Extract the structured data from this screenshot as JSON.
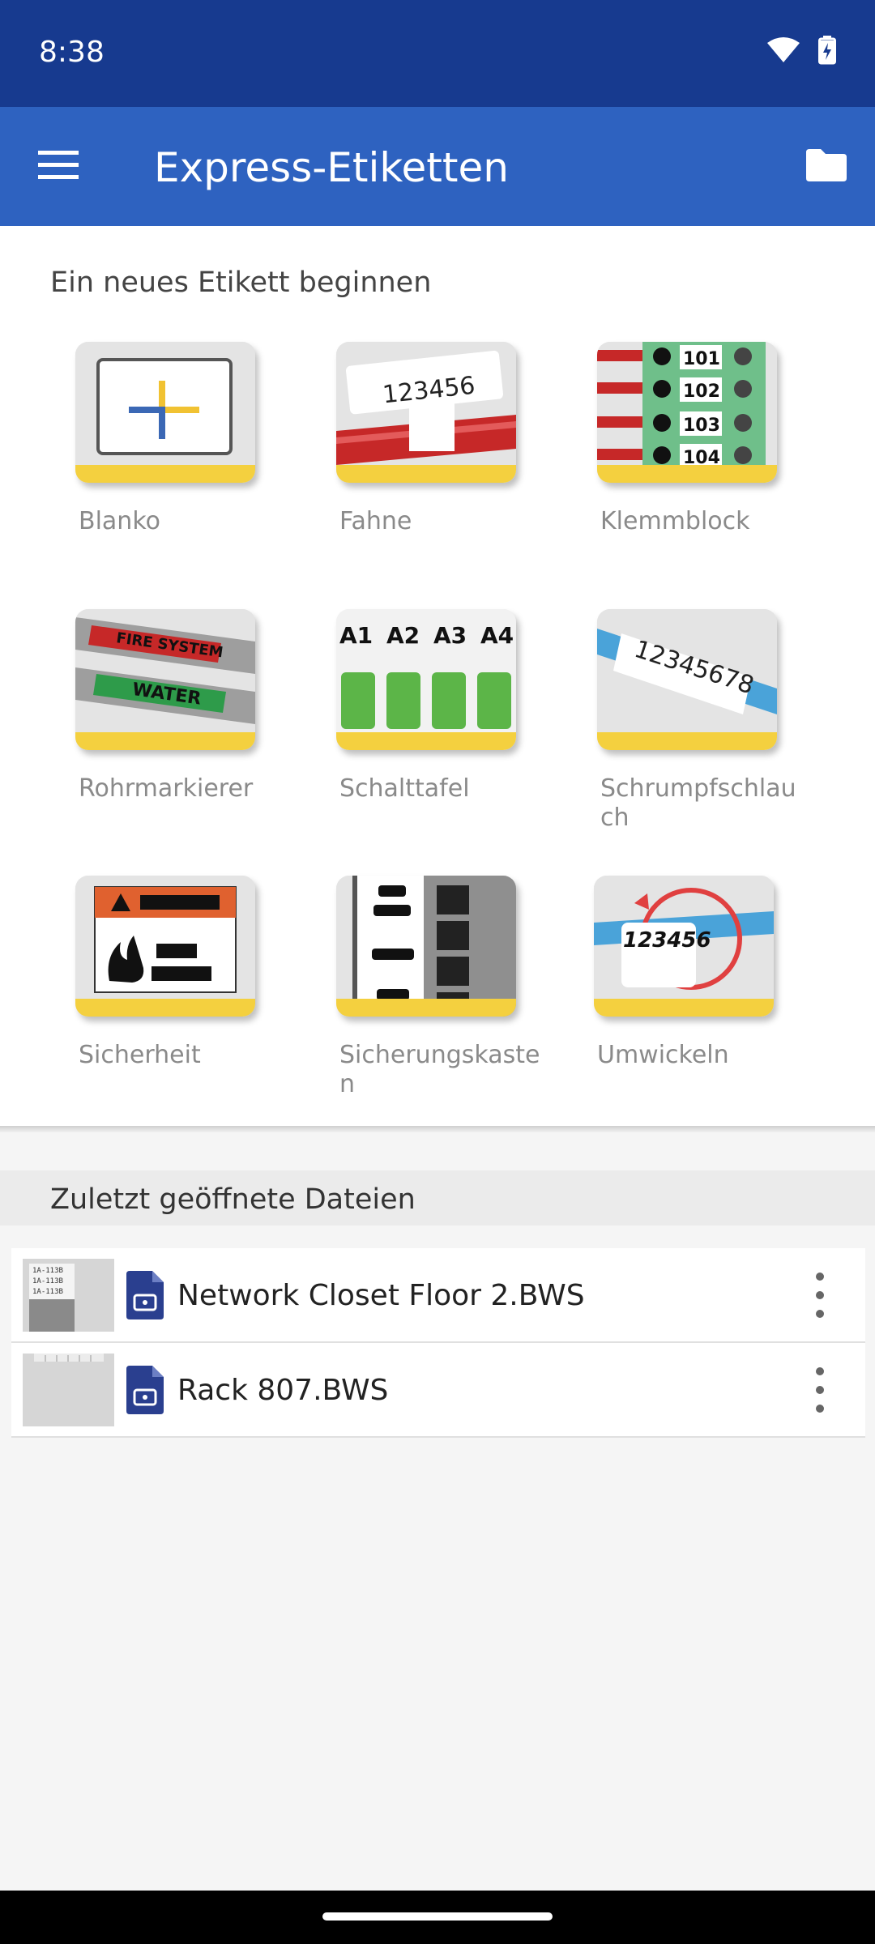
{
  "status": {
    "time": "8:38"
  },
  "app_bar": {
    "title": "Express-Etiketten"
  },
  "new_label": {
    "heading": "Ein neues Etikett beginnen",
    "tiles": [
      {
        "label": "Blanko"
      },
      {
        "label": "Fahne",
        "image_text": "123456"
      },
      {
        "label": "Klemmblock",
        "image_text": [
          "101",
          "102",
          "103",
          "104"
        ]
      },
      {
        "label": "Rohrmarkierer",
        "image_text": [
          "FIRE SYSTEM",
          "WATER"
        ]
      },
      {
        "label": "Schalttafel",
        "image_text": [
          "A1",
          "A2",
          "A3",
          "A4"
        ]
      },
      {
        "label": "Schrumpfschlauch",
        "image_text": "12345678"
      },
      {
        "label": "Sicherheit"
      },
      {
        "label": "Sicherungskasten"
      },
      {
        "label": "Umwickeln",
        "image_text": "123456"
      }
    ]
  },
  "recent": {
    "heading": "Zuletzt geöffnete Dateien",
    "files": [
      {
        "name": "Network Closet Floor 2.BWS",
        "thumb_lines": [
          "1A-113B",
          "1A-113B",
          "1A-113B"
        ]
      },
      {
        "name": "Rack 807.BWS"
      }
    ]
  },
  "icons": {
    "menu": "hamburger-icon",
    "folder": "folder-icon",
    "wifi": "wifi-icon",
    "battery": "battery-charging-icon",
    "file": "label-file-icon",
    "more": "more-vertical-icon"
  },
  "colors": {
    "status_bar": "#173a8f",
    "app_bar": "#2e62c0",
    "tile_stripe": "#f4d03f"
  }
}
